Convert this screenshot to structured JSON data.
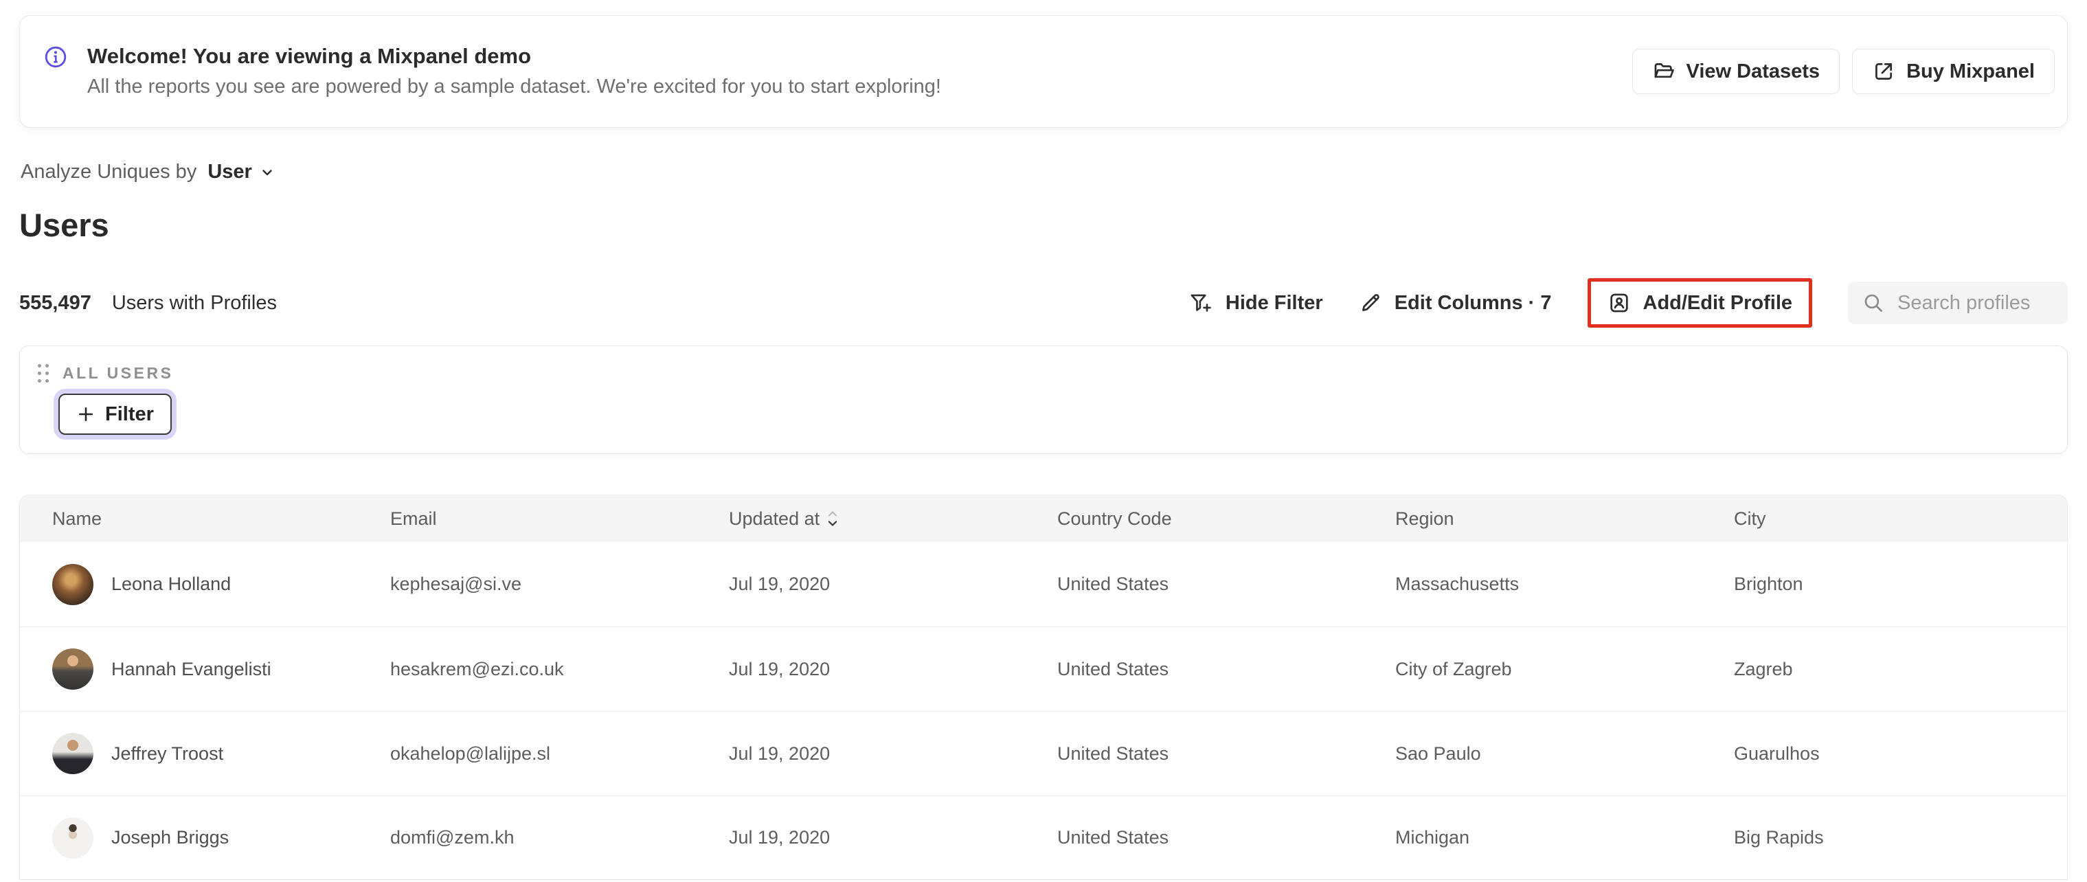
{
  "banner": {
    "title": "Welcome! You are viewing a Mixpanel demo",
    "subtitle": "All the reports you see are powered by a sample dataset. We're excited for you to start exploring!",
    "view_datasets_label": "View Datasets",
    "buy_mixpanel_label": "Buy Mixpanel"
  },
  "analyze_bar": {
    "prefix": "Analyze Uniques by",
    "selected": "User"
  },
  "page_title": "Users",
  "stats": {
    "count": "555,497",
    "label": "Users with Profiles"
  },
  "toolbar": {
    "hide_filter_label": "Hide Filter",
    "edit_columns_label": "Edit Columns · 7",
    "add_edit_profile_label": "Add/Edit Profile",
    "search_placeholder": "Search profiles"
  },
  "filter_panel": {
    "group_label": "ALL USERS",
    "filter_button_label": "Filter"
  },
  "table": {
    "columns": [
      "Name",
      "Email",
      "Updated at",
      "Country Code",
      "Region",
      "City"
    ],
    "rows": [
      {
        "name": "Leona Holland",
        "email": "kephesaj@si.ve",
        "updated_at": "Jul 19, 2020",
        "country": "United States",
        "region": "Massachusetts",
        "city": "Brighton"
      },
      {
        "name": "Hannah Evangelisti",
        "email": "hesakrem@ezi.co.uk",
        "updated_at": "Jul 19, 2020",
        "country": "United States",
        "region": "City of Zagreb",
        "city": "Zagreb"
      },
      {
        "name": "Jeffrey Troost",
        "email": "okahelop@lalijpe.sl",
        "updated_at": "Jul 19, 2020",
        "country": "United States",
        "region": "Sao Paulo",
        "city": "Guarulhos"
      },
      {
        "name": "Joseph Briggs",
        "email": "domfi@zem.kh",
        "updated_at": "Jul 19, 2020",
        "country": "United States",
        "region": "Michigan",
        "city": "Big Rapids"
      }
    ]
  },
  "colors": {
    "accent_purple": "#5b4ee8",
    "annotation_red": "#e0301f"
  }
}
